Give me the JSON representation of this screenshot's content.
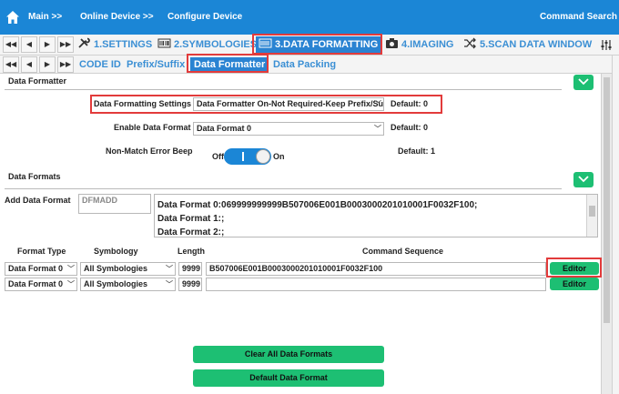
{
  "topbar": {
    "crumbs": [
      "Main >>",
      "Online Device >>",
      "Configure Device"
    ],
    "command_search": "Command Search"
  },
  "tabs_main": [
    {
      "label": "1.SETTINGS",
      "icon": "tools-icon"
    },
    {
      "label": "2.SYMBOLOGIES",
      "icon": "barcode-icon"
    },
    {
      "label": "3.DATA FORMATTING",
      "icon": "data-formatting-icon",
      "active": true
    },
    {
      "label": "4.IMAGING",
      "icon": "camera-icon"
    },
    {
      "label": "5.SCAN DATA WINDOW",
      "icon": "shuffle-icon"
    }
  ],
  "tabs_sub": [
    {
      "label": "CODE ID"
    },
    {
      "label": "Prefix/Suffix"
    },
    {
      "label": "Data Formatter",
      "active": true
    },
    {
      "label": "Data Packing"
    }
  ],
  "data_formatter": {
    "section_title": "Data Formatter",
    "settings_label": "Data Formatting Settings",
    "settings_value": "Data Formatter On-Not Required-Keep Prefix/Su",
    "settings_default": "Default: 0",
    "enable_label": "Enable Data Format",
    "enable_value": "Data Format 0",
    "enable_default": "Default: 0",
    "beep_label": "Non-Match Error Beep",
    "beep_off": "Off",
    "beep_on": "On",
    "beep_default": "Default: 1"
  },
  "data_formats": {
    "section_title": "Data Formats",
    "add_label": "Add Data Format",
    "add_placeholder": "DFMADD",
    "list": [
      "Data Format 0:069999999999B507006E001B0003000201010001F0032F100;",
      "Data Format 1:;",
      "Data Format 2:;"
    ],
    "headers": {
      "format_type": "Format Type",
      "symbology": "Symbology",
      "length": "Length",
      "command_sequence": "Command Sequence"
    },
    "rows": [
      {
        "format_type": "Data Format 0",
        "symbology": "All Symbologies",
        "length": "9999",
        "command": "B507006E001B0003000201010001F0032F100",
        "editor": "Editor"
      },
      {
        "format_type": "Data Format 0",
        "symbology": "All Symbologies",
        "length": "9999",
        "command": "",
        "editor": "Editor"
      }
    ],
    "clear_all": "Clear All Data Formats",
    "default_format": "Default Data Format"
  },
  "colors": {
    "topbar": "#1b86d6",
    "active_tab": "#2a83d2",
    "tab_text": "#3b8fd4",
    "green": "#1dbf73",
    "highlight": "#e23b3b"
  }
}
